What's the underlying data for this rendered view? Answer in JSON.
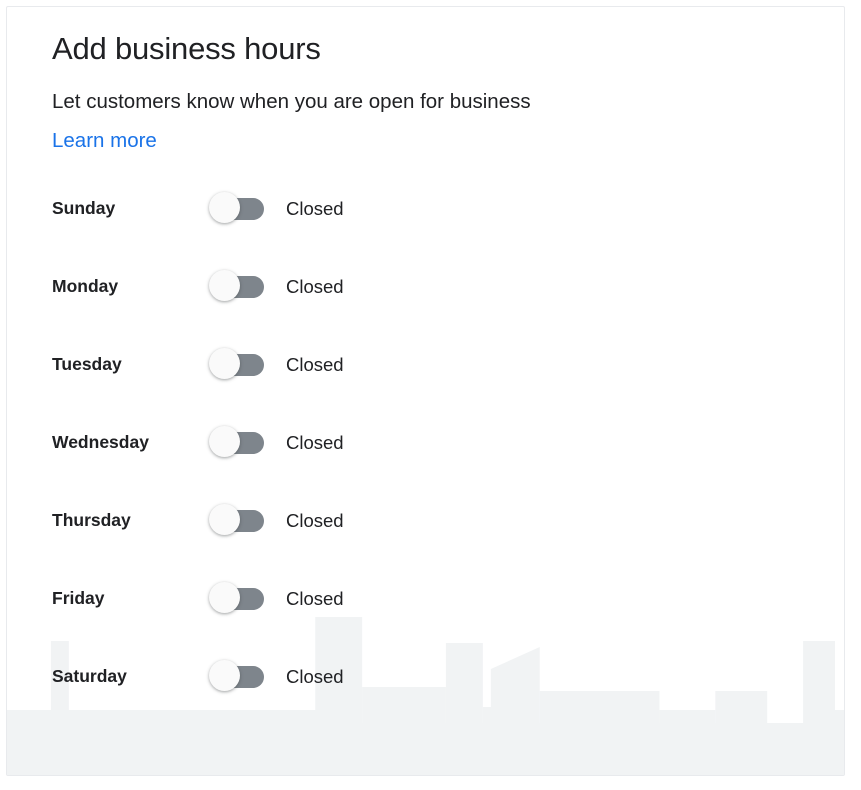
{
  "card": {
    "title": "Add business hours",
    "subtitle": "Let customers know when you are open for business",
    "learn_more_label": "Learn more"
  },
  "colors": {
    "link": "#1a73e8",
    "text": "#202124",
    "toggle_track_off": "#7e858c",
    "toggle_knob": "#fafafa",
    "card_border": "#e8eaed",
    "skyline": "#f1f3f4"
  },
  "business_hours": {
    "rows": [
      {
        "day": "Sunday",
        "state": "Closed",
        "enabled": false
      },
      {
        "day": "Monday",
        "state": "Closed",
        "enabled": false
      },
      {
        "day": "Tuesday",
        "state": "Closed",
        "enabled": false
      },
      {
        "day": "Wednesday",
        "state": "Closed",
        "enabled": false
      },
      {
        "day": "Thursday",
        "state": "Closed",
        "enabled": false
      },
      {
        "day": "Friday",
        "state": "Closed",
        "enabled": false
      },
      {
        "day": "Saturday",
        "state": "Closed",
        "enabled": false
      }
    ]
  }
}
